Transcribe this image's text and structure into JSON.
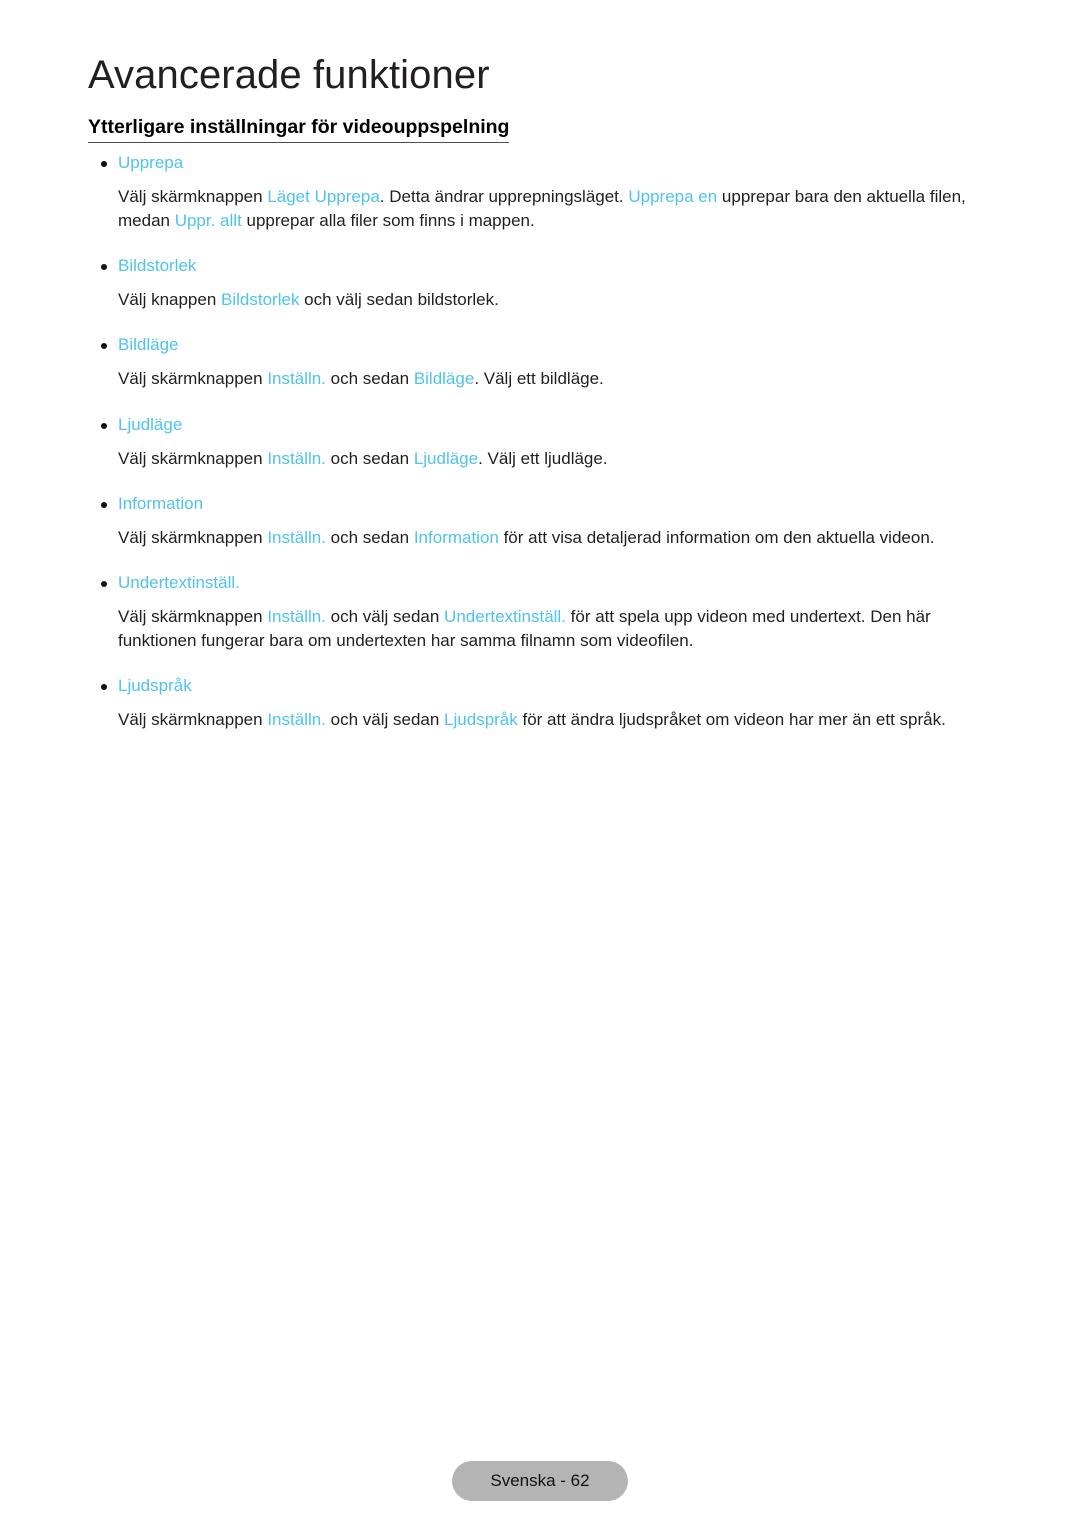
{
  "page": {
    "chapter_title": "Avancerade funktioner",
    "section_heading": "Ytterligare inställningar för videouppspelning",
    "accent_color": "#4fc3ef",
    "text_color": "#1f1f1f",
    "background_color": "#ffffff"
  },
  "topics": [
    {
      "title": "Upprepa",
      "body_parts": [
        {
          "text": "Välj skärmknappen ",
          "highlight": false
        },
        {
          "text": "Läget Upprepa",
          "highlight": true
        },
        {
          "text": ". Detta ändrar upprepningsläget. ",
          "highlight": false
        },
        {
          "text": "Upprepa en",
          "highlight": true
        },
        {
          "text": " upprepar bara den aktuella filen, medan ",
          "highlight": false
        },
        {
          "text": "Uppr. allt",
          "highlight": true
        },
        {
          "text": " upprepar alla filer som finns i mappen.",
          "highlight": false
        }
      ]
    },
    {
      "title": "Bildstorlek",
      "body_parts": [
        {
          "text": "Välj knappen ",
          "highlight": false
        },
        {
          "text": "Bildstorlek",
          "highlight": true
        },
        {
          "text": " och välj sedan bildstorlek.",
          "highlight": false
        }
      ]
    },
    {
      "title": "Bildläge",
      "body_parts": [
        {
          "text": "Välj skärmknappen ",
          "highlight": false
        },
        {
          "text": "Inställn.",
          "highlight": true
        },
        {
          "text": " och sedan ",
          "highlight": false
        },
        {
          "text": "Bildläge",
          "highlight": true
        },
        {
          "text": ". Välj ett bildläge.",
          "highlight": false
        }
      ]
    },
    {
      "title": "Ljudläge",
      "body_parts": [
        {
          "text": "Välj skärmknappen ",
          "highlight": false
        },
        {
          "text": "Inställn.",
          "highlight": true
        },
        {
          "text": " och sedan ",
          "highlight": false
        },
        {
          "text": "Ljudläge",
          "highlight": true
        },
        {
          "text": ". Välj ett ljudläge.",
          "highlight": false
        }
      ]
    },
    {
      "title": "Information",
      "body_parts": [
        {
          "text": "Välj skärmknappen ",
          "highlight": false
        },
        {
          "text": "Inställn.",
          "highlight": true
        },
        {
          "text": " och sedan ",
          "highlight": false
        },
        {
          "text": "Information",
          "highlight": true
        },
        {
          "text": " för att visa detaljerad information om den aktuella videon.",
          "highlight": false
        }
      ]
    },
    {
      "title": "Undertextinställ.",
      "body_parts": [
        {
          "text": "Välj skärmknappen ",
          "highlight": false
        },
        {
          "text": "Inställn.",
          "highlight": true
        },
        {
          "text": " och välj sedan ",
          "highlight": false
        },
        {
          "text": "Undertextinställ.",
          "highlight": true
        },
        {
          "text": " för att spela upp videon med undertext. Den här funktionen fungerar bara om undertexten har samma filnamn som videofilen.",
          "highlight": false
        }
      ]
    },
    {
      "title": "Ljudspråk",
      "body_parts": [
        {
          "text": "Välj skärmknappen ",
          "highlight": false
        },
        {
          "text": "Inställn.",
          "highlight": true
        },
        {
          "text": " och välj sedan ",
          "highlight": false
        },
        {
          "text": "Ljudspråk",
          "highlight": true
        },
        {
          "text": " för att ändra ljudspråket om videon har mer än ett språk.",
          "highlight": false
        }
      ]
    }
  ],
  "footer": {
    "label": "Svenska - 62"
  }
}
